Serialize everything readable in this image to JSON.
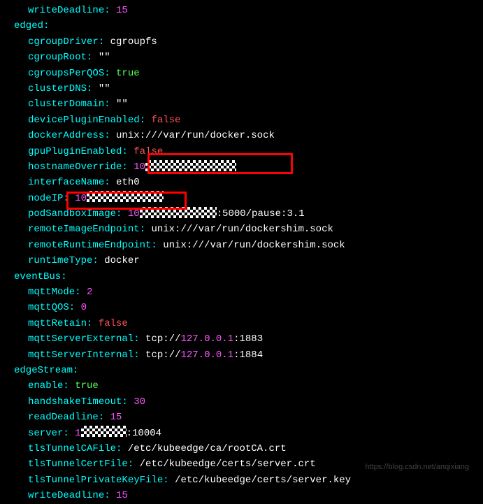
{
  "partial_top": {
    "writeDeadline": "15"
  },
  "edged": {
    "title": "edged:",
    "cgroupDriver": {
      "k": "cgroupDriver:",
      "v": "cgroupfs"
    },
    "cgroupRoot": {
      "k": "cgroupRoot:",
      "v": "\"\""
    },
    "cgroupsPerQOS": {
      "k": "cgroupsPerQOS:",
      "v": "true"
    },
    "clusterDNS": {
      "k": "clusterDNS:",
      "v": "\"\""
    },
    "clusterDomain": {
      "k": "clusterDomain:",
      "v": "\"\""
    },
    "devicePluginEnabled": {
      "k": "devicePluginEnabled:",
      "v": "false"
    },
    "dockerAddress": {
      "k": "dockerAddress:",
      "v": "unix:///var/run/docker.sock"
    },
    "gpuPluginEnabled": {
      "k": "gpuPluginEnabled:",
      "v": "false"
    },
    "hostnameOverride": {
      "k": "hostnameOverride:",
      "v": "10"
    },
    "interfaceName": {
      "k": "interfaceName:",
      "v": "eth0"
    },
    "nodeIP": {
      "k": "nodeIP:",
      "v": "10"
    },
    "podSandboxImage": {
      "k": "podSandboxImage:",
      "v1": "10",
      "v2": ":5000/pause:3.1"
    },
    "remoteImageEndpoint": {
      "k": "remoteImageEndpoint:",
      "v": "unix:///var/run/dockershim.sock"
    },
    "remoteRuntimeEndpoint": {
      "k": "remoteRuntimeEndpoint:",
      "v": "unix:///var/run/dockershim.sock"
    },
    "runtimeType": {
      "k": "runtimeType:",
      "v": "docker"
    }
  },
  "eventBus": {
    "title": "eventBus:",
    "mqttMode": {
      "k": "mqttMode:",
      "v": "2"
    },
    "mqttQOS": {
      "k": "mqttQOS:",
      "v": "0"
    },
    "mqttRetain": {
      "k": "mqttRetain:",
      "v": "false"
    },
    "mqttServerExternal": {
      "k": "mqttServerExternal:",
      "pre": "tcp://",
      "ip": "127.0.0.1",
      "port": ":1883"
    },
    "mqttServerInternal": {
      "k": "mqttServerInternal:",
      "pre": "tcp://",
      "ip": "127.0.0.1",
      "port": ":1884"
    }
  },
  "edgeStream": {
    "title": "edgeStream:",
    "enable": {
      "k": "enable:",
      "v": "true"
    },
    "handshakeTimeout": {
      "k": "handshakeTimeout:",
      "v": "30"
    },
    "readDeadline": {
      "k": "readDeadline:",
      "v": "15"
    },
    "server": {
      "k": "server:",
      "v1": "1",
      "v2": ":10004"
    },
    "tlsTunnelCAFile": {
      "k": "tlsTunnelCAFile:",
      "v": "/etc/kubeedge/ca/rootCA.crt"
    },
    "tlsTunnelCertFile": {
      "k": "tlsTunnelCertFile:",
      "v": "/etc/kubeedge/certs/server.crt"
    },
    "tlsTunnelPrivateKeyFile": {
      "k": "tlsTunnelPrivateKeyFile:",
      "v": "/etc/kubeedge/certs/server.key"
    },
    "writeDeadline": {
      "k": "writeDeadline:",
      "v": "15"
    }
  },
  "watermark": "https://blog.csdn.net/anqixiang"
}
